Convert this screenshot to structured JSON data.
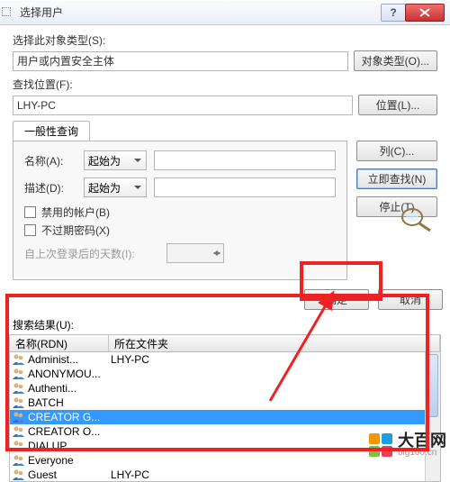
{
  "window": {
    "title": "选择用户"
  },
  "section1": {
    "label": "选择此对象类型(S):",
    "value": "用户或内置安全主体",
    "btn": "对象类型(O)..."
  },
  "section2": {
    "label": "查找位置(F):",
    "value": "LHY-PC",
    "btn": "位置(L)..."
  },
  "tab": {
    "label": "一般性查询"
  },
  "form": {
    "name_cap": "名称(A):",
    "desc_cap": "描述(D):",
    "select_val": "起始为",
    "chk1": "禁用的帐户(B)",
    "chk2": "不过期密码(X)",
    "days_cap": "自上次登录后的天数(I):"
  },
  "side": {
    "col": "列(C)...",
    "find": "立即查找(N)",
    "stop": "停止(T)"
  },
  "dlg": {
    "ok": "确定",
    "cancel": "取消"
  },
  "results": {
    "label": "搜索结果(U):",
    "col1": "名称(RDN)",
    "col2": "所在文件夹",
    "rows": [
      {
        "name": "Administ...",
        "folder": "LHY-PC"
      },
      {
        "name": "ANONYMOU...",
        "folder": ""
      },
      {
        "name": "Authenti...",
        "folder": ""
      },
      {
        "name": "BATCH",
        "folder": ""
      },
      {
        "name": "CREATOR G...",
        "folder": "",
        "sel": true
      },
      {
        "name": "CREATOR O...",
        "folder": ""
      },
      {
        "name": "DIALUP",
        "folder": ""
      },
      {
        "name": "Everyone",
        "folder": ""
      },
      {
        "name": "Guest",
        "folder": "LHY-PC"
      }
    ]
  },
  "brand": {
    "name": "大百网",
    "sub": "big100.cn"
  },
  "colors": {
    "sq": [
      "#f39800",
      "#1e9edb",
      "#7ac143",
      "#e83e57"
    ]
  }
}
